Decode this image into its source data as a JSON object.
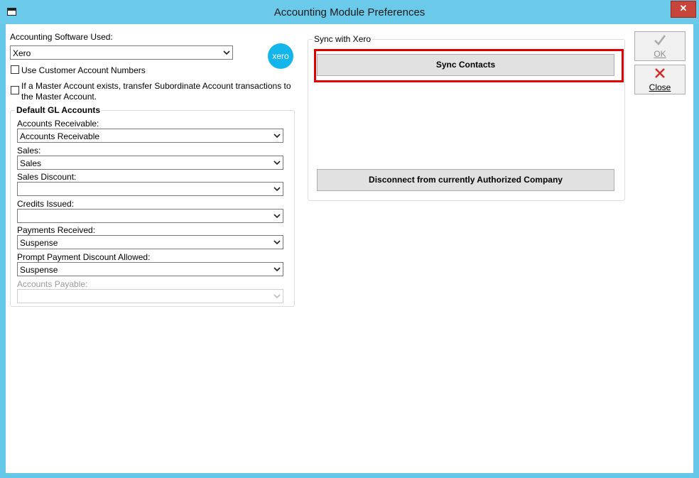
{
  "window": {
    "title": "Accounting Module Preferences"
  },
  "software": {
    "label": "Accounting Software Used:",
    "value": "Xero",
    "logo_text": "xero",
    "use_customer_numbers": "Use Customer Account Numbers",
    "master_account_line1": "If a Master Account exists, transfer Subordinate Account transactions to",
    "master_account_line2": "the Master Account."
  },
  "gl": {
    "title": "Default GL Accounts",
    "fields": [
      {
        "label": "Accounts Receivable:",
        "value": "Accounts Receivable"
      },
      {
        "label": "Sales:",
        "value": "Sales"
      },
      {
        "label": "Sales Discount:",
        "value": ""
      },
      {
        "label": "Credits Issued:",
        "value": ""
      },
      {
        "label": "Payments Received:",
        "value": "Suspense"
      },
      {
        "label": "Prompt Payment Discount Allowed:",
        "value": "Suspense"
      },
      {
        "label": "Accounts Payable:",
        "value": ""
      }
    ]
  },
  "sync": {
    "title": "Sync with Xero",
    "sync_contacts": "Sync Contacts",
    "disconnect": "Disconnect from currently Authorized Company"
  },
  "actions": {
    "ok": "OK",
    "close": "Close"
  },
  "colors": {
    "titlebar": "#6bc9ea",
    "highlight": "#e00000",
    "xero_brand": "#13b5ea",
    "close_x": "#d42a2a"
  }
}
